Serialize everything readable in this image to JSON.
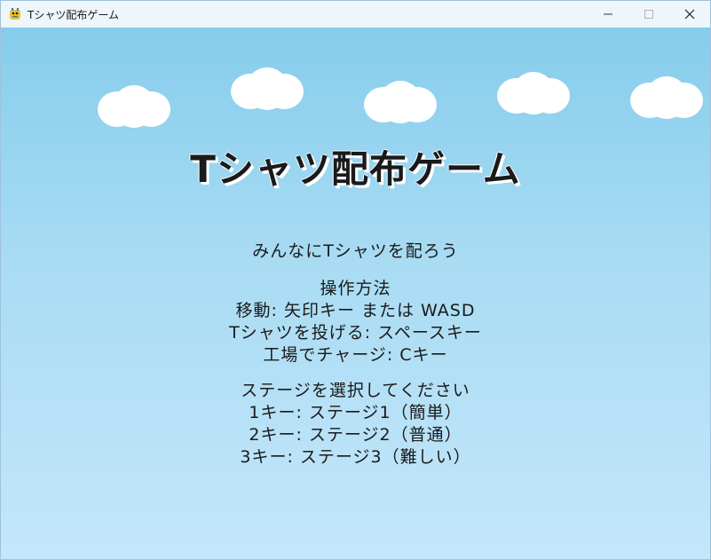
{
  "window": {
    "title": "Tシャツ配布ゲーム",
    "icons": {
      "app": "pygame-snake-icon",
      "minimize": "minimize-icon",
      "maximize": "maximize-icon",
      "close": "close-icon"
    }
  },
  "game": {
    "title": "Tシャツ配布ゲーム",
    "subtitle": "みんなにTシャツを配ろう",
    "controls": {
      "heading": "操作方法",
      "move": "移動: 矢印キー または WASD",
      "throw": "Tシャツを投げる: スペースキー",
      "charge": "工場でチャージ: Cキー"
    },
    "stage_select": {
      "heading": "ステージを選択してください",
      "stage1": "1キー: ステージ1（簡単）",
      "stage2": "2キー: ステージ2（普通）",
      "stage3": "3キー: ステージ3（難しい）"
    },
    "colors": {
      "sky_top": "#86cdec",
      "sky_bottom": "#c4e6fa",
      "cloud": "#ffffff",
      "text": "#1a1a1a"
    }
  }
}
